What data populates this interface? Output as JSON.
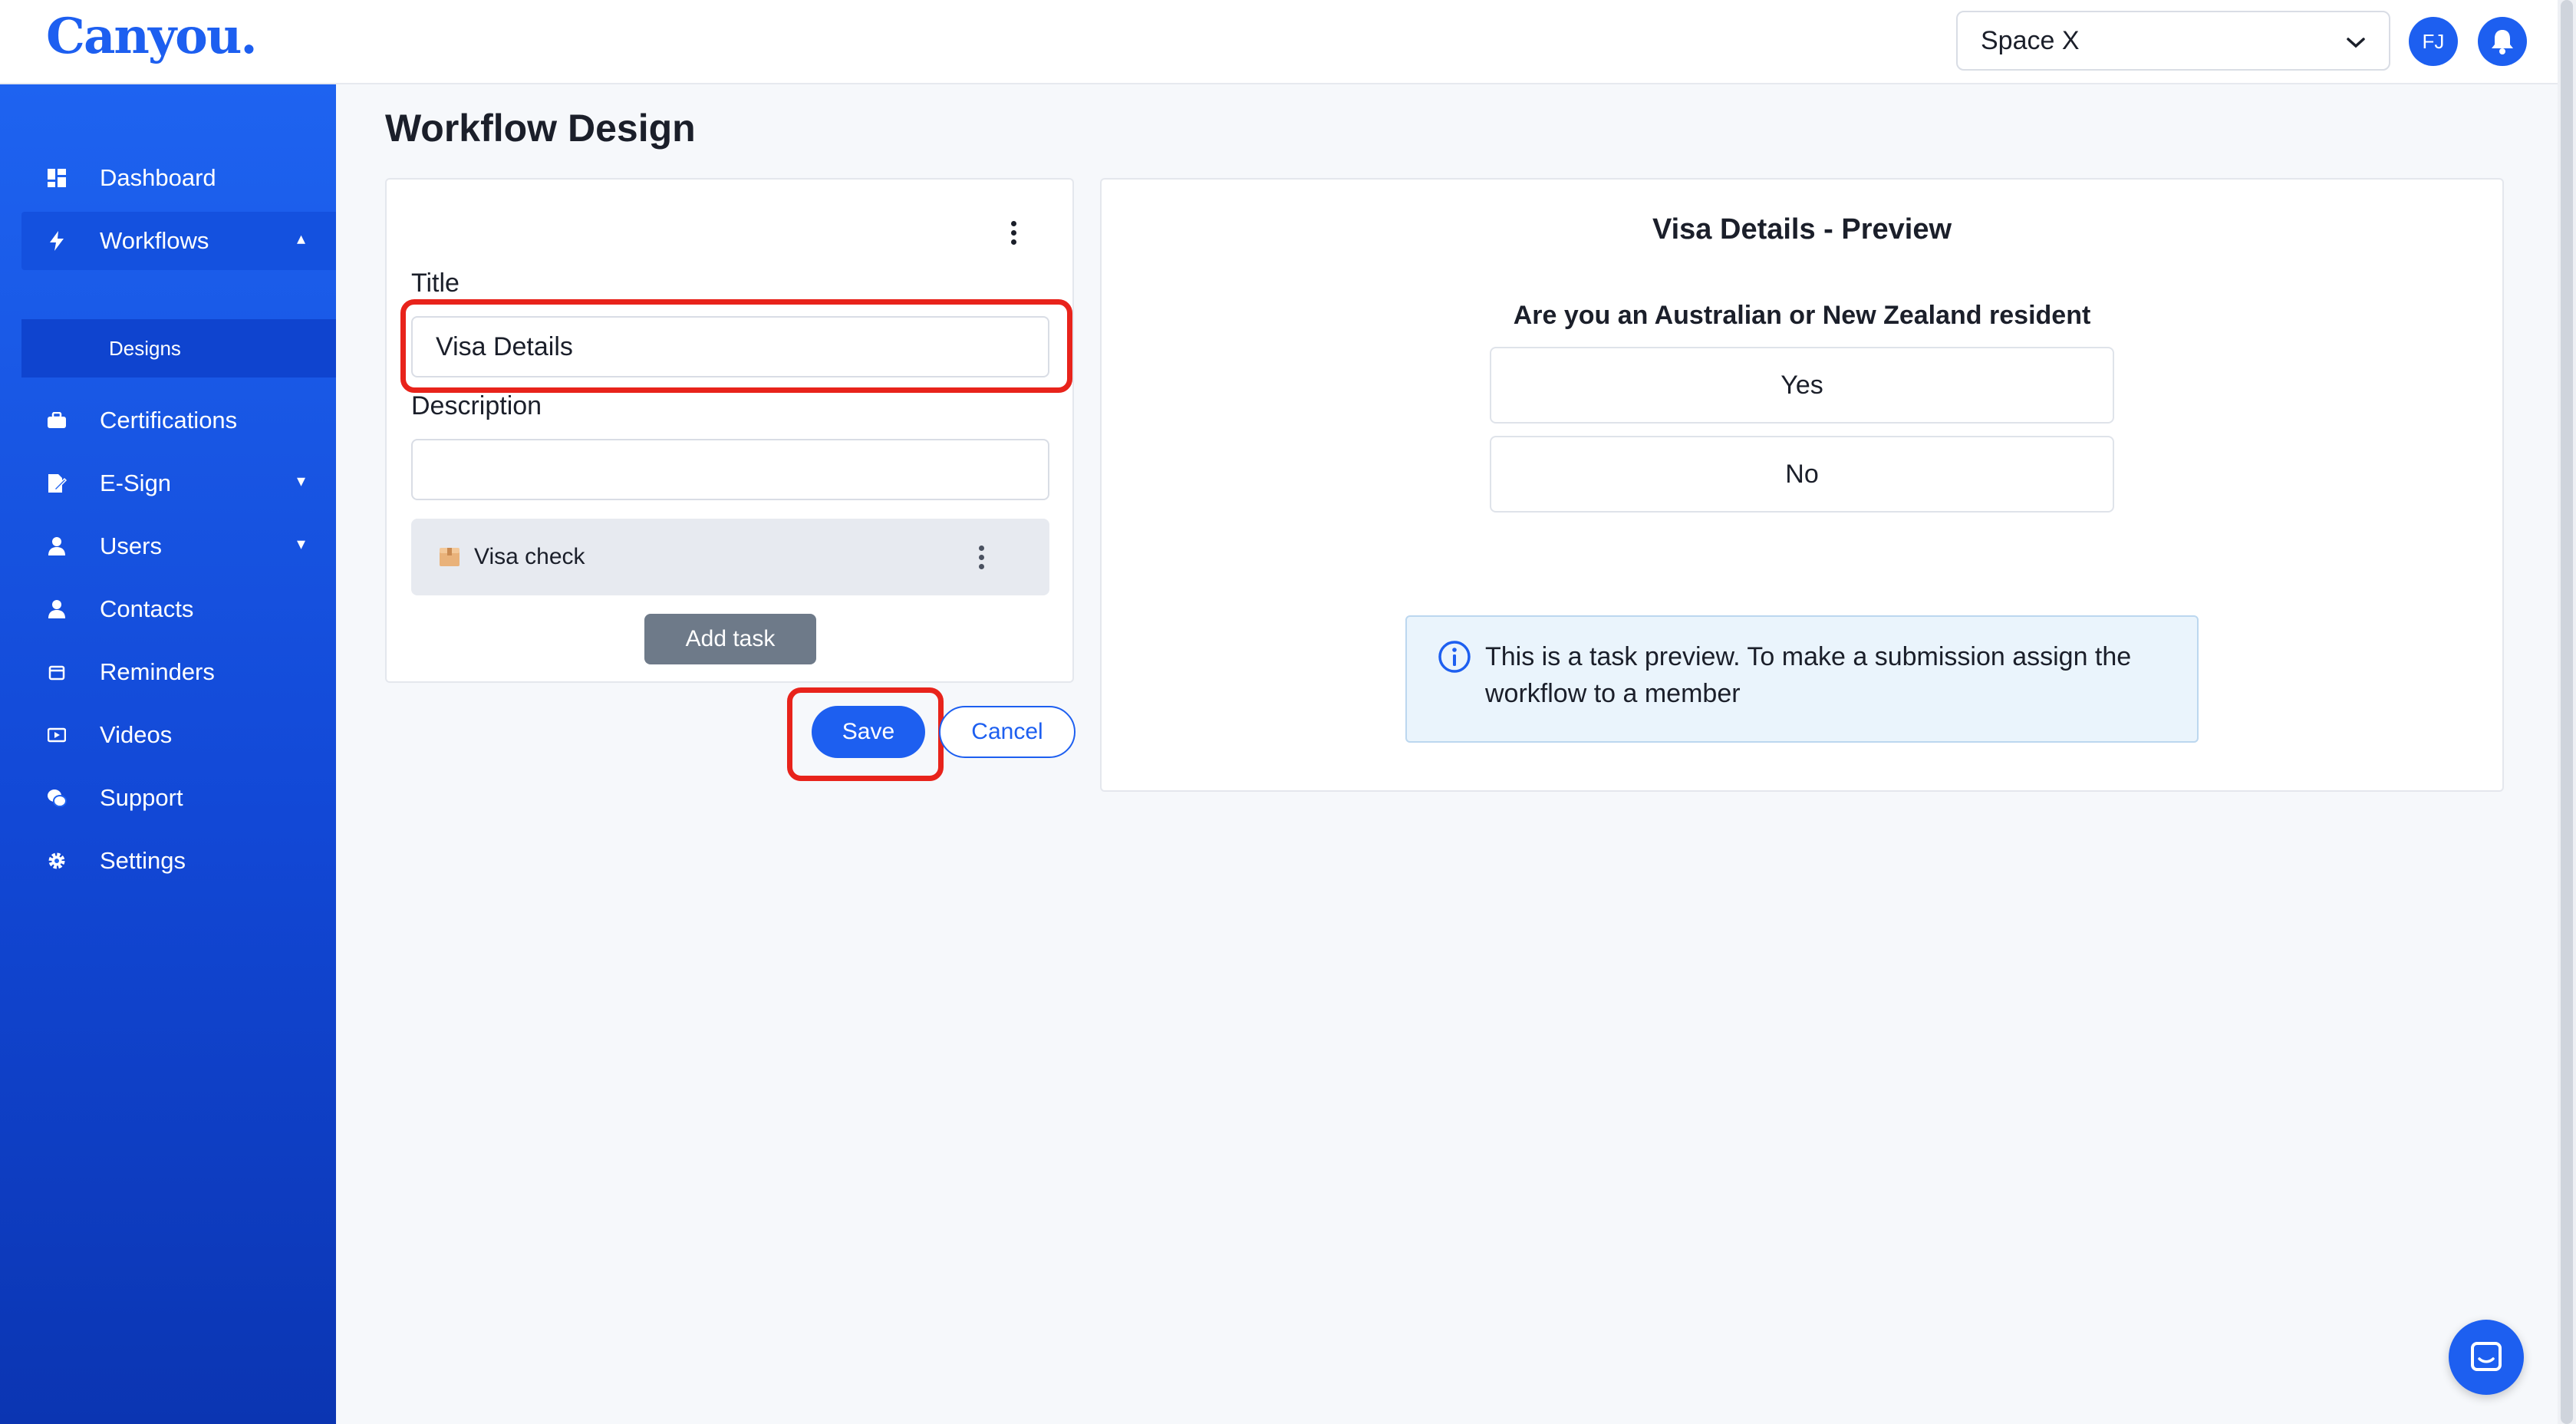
{
  "app": {
    "logo": "Canyou."
  },
  "header": {
    "space_select": {
      "value": "Space X"
    },
    "avatar_initials": "FJ"
  },
  "sidebar": {
    "items": [
      {
        "label": "Dashboard",
        "icon": "dashboard-icon"
      },
      {
        "label": "Workflows",
        "icon": "bolt-icon",
        "expanded": true
      },
      {
        "label": "Certifications",
        "icon": "briefcase-icon"
      },
      {
        "label": "E-Sign",
        "icon": "sign-icon",
        "has_caret": true
      },
      {
        "label": "Users",
        "icon": "user-icon",
        "has_caret": true
      },
      {
        "label": "Contacts",
        "icon": "contact-icon"
      },
      {
        "label": "Reminders",
        "icon": "calendar-icon"
      },
      {
        "label": "Videos",
        "icon": "video-icon"
      },
      {
        "label": "Support",
        "icon": "support-icon"
      },
      {
        "label": "Settings",
        "icon": "gear-icon"
      }
    ],
    "sub_items": [
      {
        "label": "Designs"
      }
    ]
  },
  "main": {
    "page_title": "Workflow Design",
    "form": {
      "title_label": "Title",
      "title_value": "Visa Details",
      "description_label": "Description",
      "description_value": "",
      "tasks": [
        {
          "label": "Visa check"
        }
      ],
      "add_task_label": "Add task",
      "save_label": "Save",
      "cancel_label": "Cancel"
    },
    "preview": {
      "title": "Visa Details - Preview",
      "question": "Are you an Australian or New Zealand resident",
      "options": [
        "Yes",
        "No"
      ],
      "info_text": "This is a task preview. To make a submission assign the workflow to a member"
    }
  },
  "colors": {
    "accent": "#1d5ff0",
    "highlight": "#e8231b",
    "sidebar_top": "#1e63f0",
    "sidebar_bottom": "#0b35b2"
  }
}
